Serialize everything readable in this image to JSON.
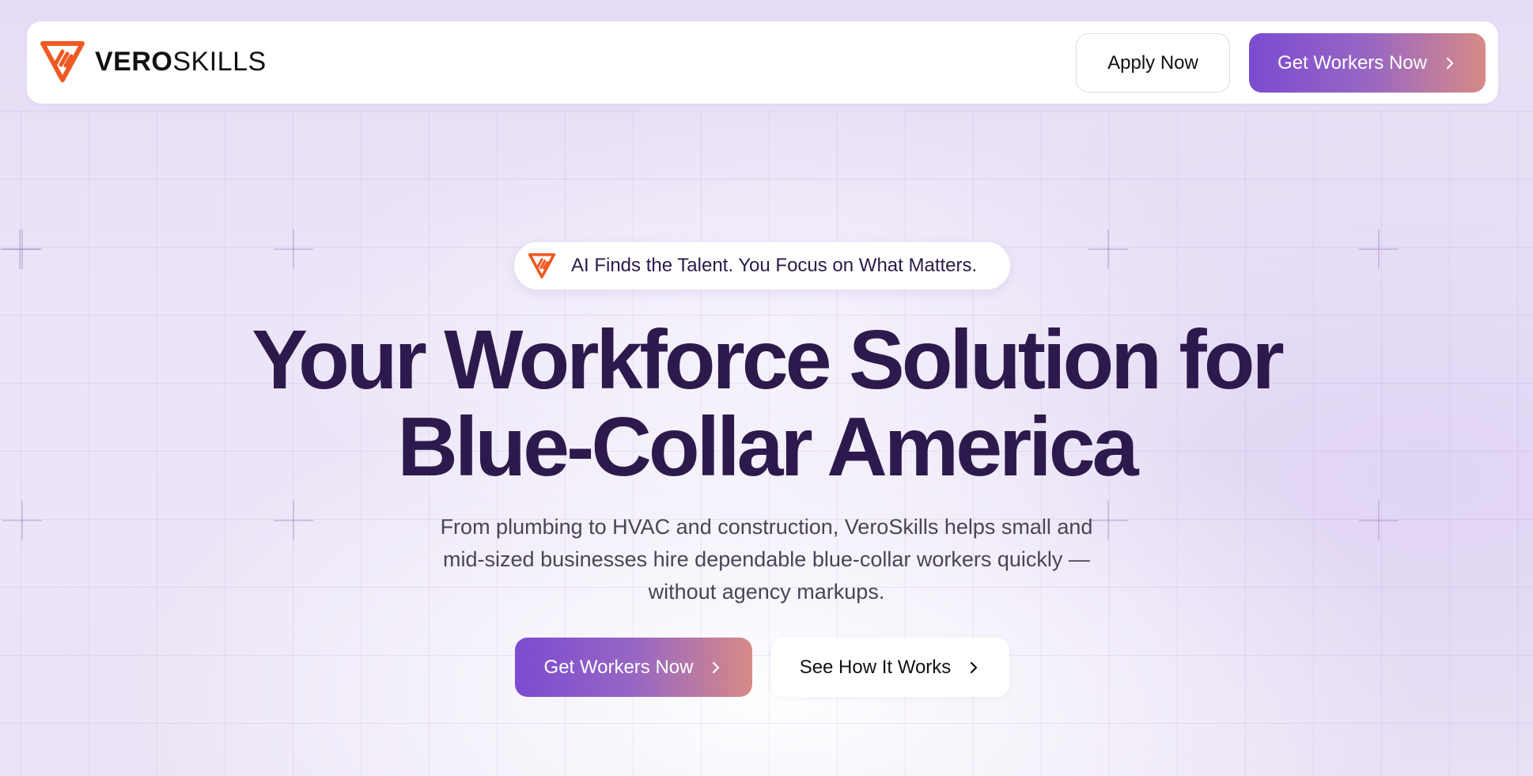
{
  "brand": {
    "name_bold": "VERO",
    "name_regular": "SKILLS",
    "logo_icon": "veroskills-logo-icon",
    "accent_color": "#ee5a24"
  },
  "header": {
    "apply_label": "Apply Now",
    "cta_label": "Get Workers Now"
  },
  "hero": {
    "badge_text": "AI Finds the Talent. You Focus on What Matters.",
    "title": "Your Workforce Solution for\nBlue-Collar America",
    "subtitle": "From plumbing to HVAC and construction, VeroSkills helps small and mid-sized businesses hire dependable blue-collar workers quickly — without agency markups.",
    "primary_cta_label": "Get Workers Now",
    "secondary_cta_label": "See How It Works"
  },
  "colors": {
    "gradient_start": "#7b4bd1",
    "gradient_end": "#d78a86",
    "heading": "#2d1a4d"
  }
}
